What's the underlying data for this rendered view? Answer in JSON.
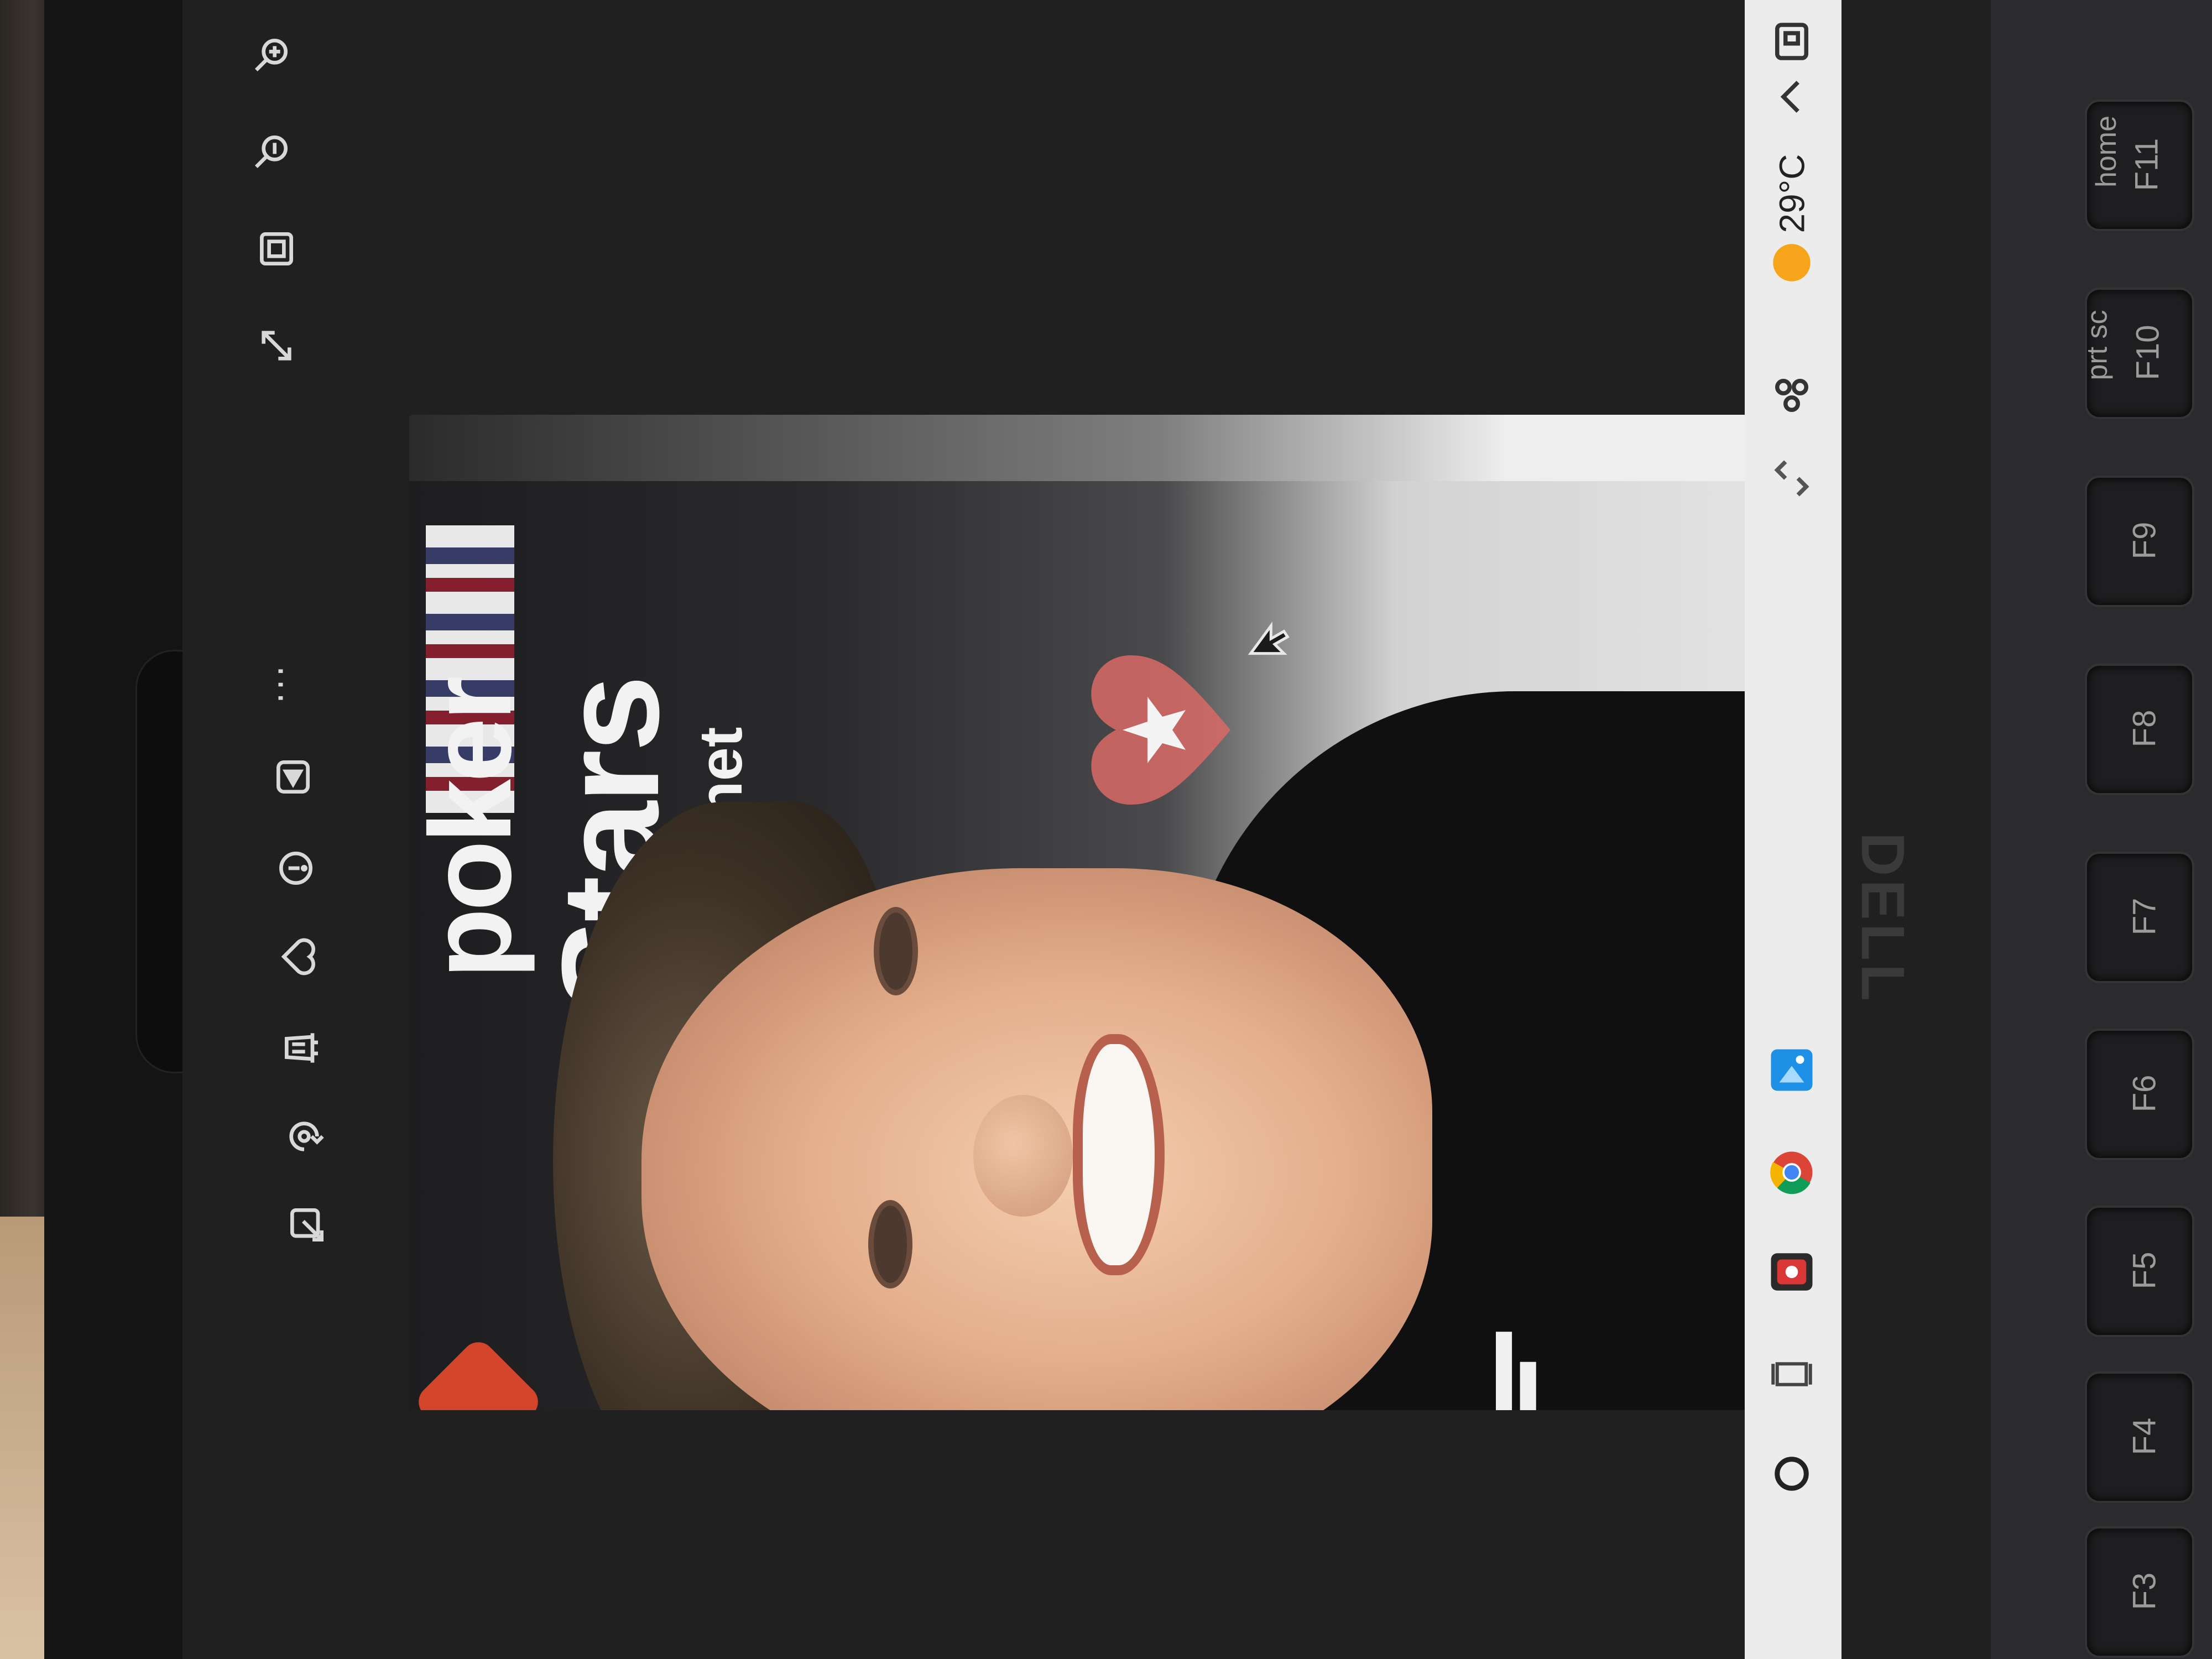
{
  "toolbar": {
    "items": [
      {
        "name": "zoom-in-icon"
      },
      {
        "name": "zoom-out-icon"
      },
      {
        "name": "actual-size-icon"
      },
      {
        "name": "fullscreen-icon"
      },
      {
        "name": "more-icon",
        "label": "..."
      },
      {
        "name": "add-to-album-icon"
      },
      {
        "name": "info-icon"
      },
      {
        "name": "favorite-icon"
      },
      {
        "name": "delete-icon"
      },
      {
        "name": "rotate-icon"
      },
      {
        "name": "edit-icon"
      }
    ]
  },
  "photo": {
    "logo_word_1": "poker",
    "logo_word_2": "Stars",
    "logo_word_3": ".net"
  },
  "taskbar": {
    "temperature": "29°C",
    "items": [
      {
        "name": "search-circle-icon"
      },
      {
        "name": "task-view-icon"
      },
      {
        "name": "camera-app-icon"
      },
      {
        "name": "chrome-icon"
      },
      {
        "name": "photos-app-icon"
      },
      {
        "name": "nav-arrows-icon"
      },
      {
        "name": "widgets-icon"
      },
      {
        "name": "weather-sun-icon"
      },
      {
        "name": "chevron-up-icon"
      },
      {
        "name": "tray-device-icon"
      }
    ]
  },
  "keyboard": {
    "brand": "DELL",
    "keys": [
      {
        "main": "F11",
        "sub": "home"
      },
      {
        "main": "F10",
        "sub": "prt sc"
      },
      {
        "main": "F9",
        "sub": ""
      },
      {
        "main": "F8",
        "sub": ""
      },
      {
        "main": "F7",
        "sub": ""
      },
      {
        "main": "F6",
        "sub": ""
      },
      {
        "main": "F5",
        "sub": ""
      },
      {
        "main": "F4",
        "sub": ""
      },
      {
        "main": "F3",
        "sub": ""
      }
    ]
  },
  "colors": {
    "screen_bg": "#202020",
    "taskbar_bg": "#ececec",
    "weather_sun": "#f6a51a",
    "photos_accent": "#1e90e6",
    "camera_red": "#d93636"
  }
}
